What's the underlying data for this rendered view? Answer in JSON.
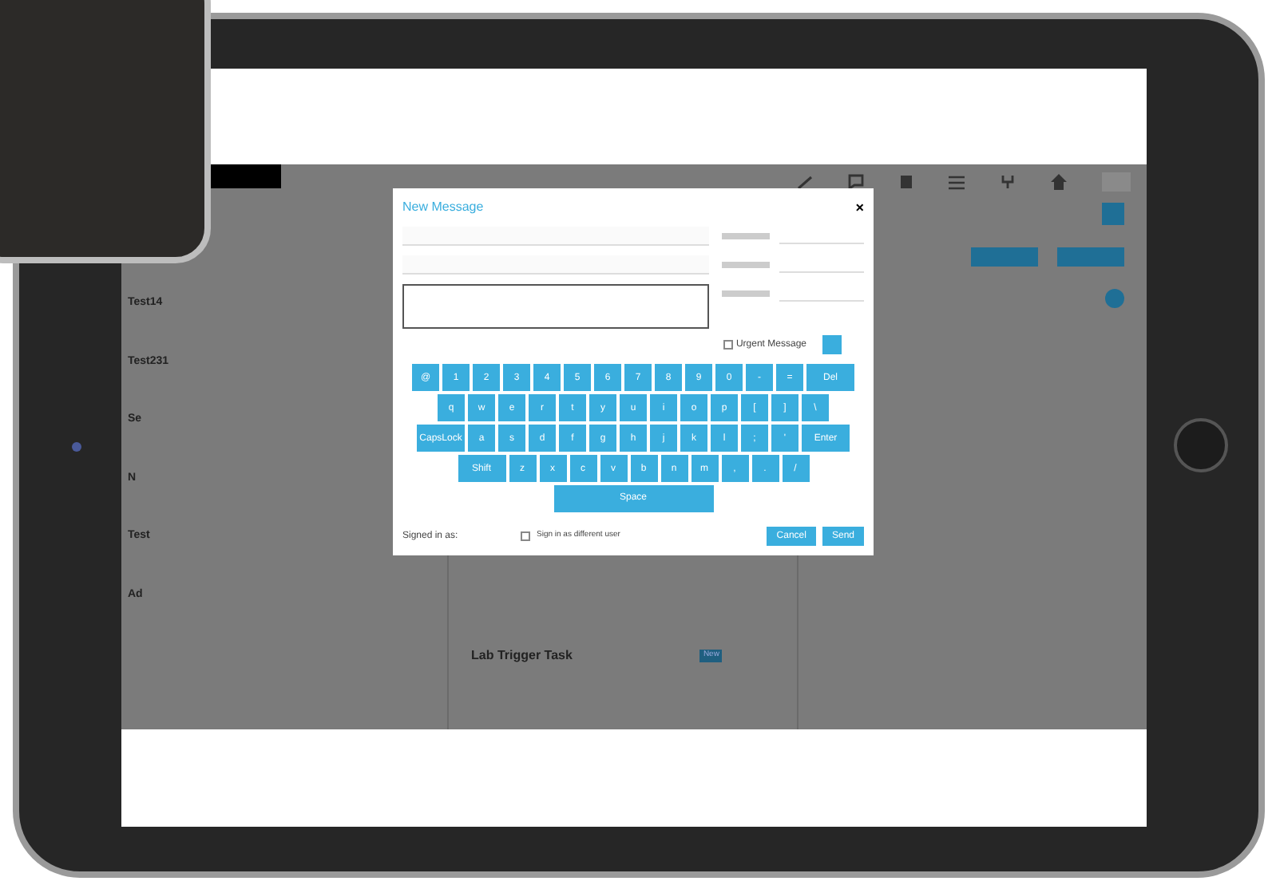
{
  "left_list": [
    {
      "title": "Test14"
    },
    {
      "title": "Test231"
    },
    {
      "title": "Se"
    },
    {
      "title": "N"
    },
    {
      "title": "Test"
    },
    {
      "title": "Ad"
    }
  ],
  "middle_list": [
    {
      "title": "Lab Trigger Task",
      "badge": "New"
    }
  ],
  "modal": {
    "title": "New Message",
    "close": "×",
    "urgent": {
      "label": "Urgent Message",
      "checked": false
    },
    "keyboard": [
      [
        "@",
        "1",
        "2",
        "3",
        "4",
        "5",
        "6",
        "7",
        "8",
        "9",
        "0",
        "-",
        "=",
        {
          "label": "Del",
          "kind": "wide"
        }
      ],
      [
        "q",
        "w",
        "e",
        "r",
        "t",
        "y",
        "u",
        "i",
        "o",
        "p",
        "[",
        "]",
        "\\"
      ],
      [
        {
          "label": "CapsLock",
          "kind": "wide"
        },
        "a",
        "s",
        "d",
        "f",
        "g",
        "h",
        "j",
        "k",
        "l",
        ";",
        "'",
        {
          "label": "Enter",
          "kind": "wide"
        }
      ],
      [
        {
          "label": "Shift",
          "kind": "wide"
        },
        "z",
        "x",
        "c",
        "v",
        "b",
        "n",
        "m",
        ",",
        ".",
        "/"
      ]
    ],
    "space": "Space",
    "signed_in_label": "Signed in as:",
    "different_user": {
      "label": "Sign in as different user",
      "checked": false
    },
    "buttons": [
      "Cancel",
      "Send"
    ]
  }
}
